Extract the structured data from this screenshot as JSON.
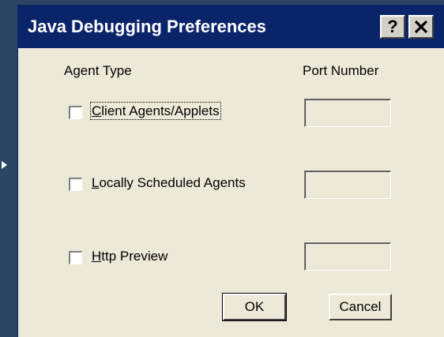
{
  "dialog": {
    "title": "Java Debugging Preferences",
    "help_label": "?",
    "headers": {
      "agent_type": "Agent Type",
      "port_number": "Port Number"
    },
    "agents": [
      {
        "prefix": "",
        "mnemonic": "C",
        "rest": "lient Agents/Applets",
        "checked": false,
        "port_value": ""
      },
      {
        "prefix": "",
        "mnemonic": "L",
        "rest": "ocally Scheduled Agents",
        "checked": false,
        "port_value": ""
      },
      {
        "prefix": "",
        "mnemonic": "H",
        "rest": "ttp Preview",
        "checked": false,
        "port_value": ""
      }
    ],
    "ok_label": "OK",
    "cancel_label": "Cancel"
  },
  "icons": {
    "close": "close-icon",
    "help": "help-icon",
    "pointer": "arrow-right-icon"
  },
  "colors": {
    "titlebar": "#0a246a",
    "dialog_bg": "#ece9d8",
    "desktop": "#2b4663"
  }
}
